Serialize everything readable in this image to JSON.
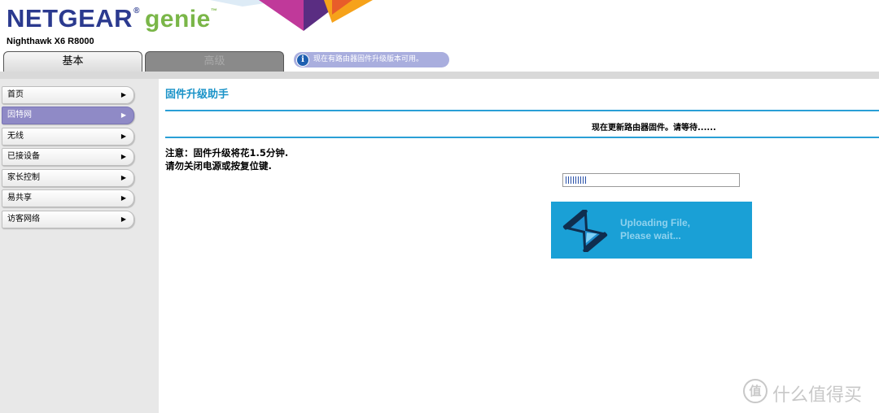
{
  "header": {
    "brand": "NETGEAR",
    "brand_reg": "®",
    "brand_product": "genie",
    "brand_tm": "™",
    "model": "Nighthawk X6 R8000"
  },
  "tabs": {
    "basic": "基本",
    "advanced": "高级"
  },
  "notice": {
    "icon": "info-icon",
    "text": "现在有路由器固件升级版本可用。"
  },
  "sidebar": {
    "items": [
      {
        "label": "首页",
        "active": false
      },
      {
        "label": "因特网",
        "active": true
      },
      {
        "label": "无线",
        "active": false
      },
      {
        "label": "已接设备",
        "active": false
      },
      {
        "label": "家长控制",
        "active": false
      },
      {
        "label": "易共享",
        "active": false
      },
      {
        "label": "访客网络",
        "active": false
      }
    ]
  },
  "main": {
    "title": "固件升级助手",
    "status": "现在更新路由器固件。请等待......",
    "warning_line1": "注意：固件升级将花1.5分钟.",
    "warning_line2": "请勿关闭电源或按复位键.",
    "progress_fraction": 0.13,
    "upload_line1": "Uploading File,",
    "upload_line2": "Please wait..."
  },
  "watermark": {
    "icon": "zhi-logo",
    "logo_char": "值",
    "text": "什么值得买"
  },
  "colors": {
    "brand_blue": "#2b3a8f",
    "genie_green": "#7ab648",
    "accent_blue": "#1a93c8",
    "active_nav": "#8f8ac6",
    "upload_box": "#1aa0d6"
  }
}
